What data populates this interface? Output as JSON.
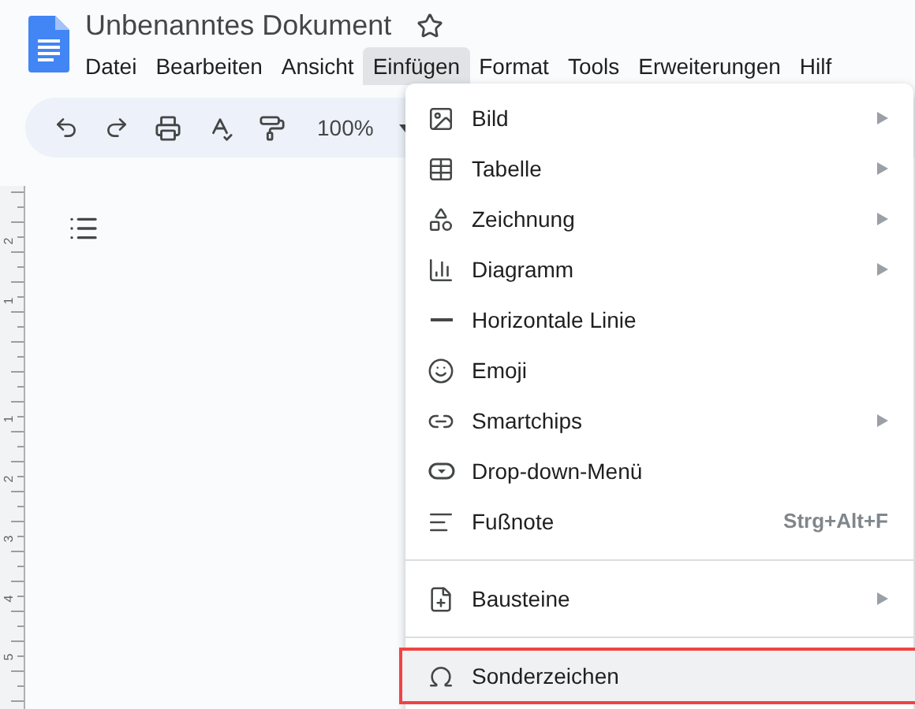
{
  "document": {
    "title": "Unbenanntes Dokument",
    "starred": false
  },
  "menubar": [
    {
      "label": "Datei",
      "selected": false
    },
    {
      "label": "Bearbeiten",
      "selected": false
    },
    {
      "label": "Ansicht",
      "selected": false
    },
    {
      "label": "Einfügen",
      "selected": true
    },
    {
      "label": "Format",
      "selected": false
    },
    {
      "label": "Tools",
      "selected": false
    },
    {
      "label": "Erweiterungen",
      "selected": false
    },
    {
      "label": "Hilf",
      "selected": false
    }
  ],
  "toolbar": {
    "zoom": "100%"
  },
  "ruler": {
    "labels": [
      "2",
      "1",
      "1",
      "2",
      "3",
      "4",
      "5"
    ]
  },
  "insert_menu": [
    {
      "kind": "item",
      "label": "Bild",
      "submenu": true,
      "selected": false
    },
    {
      "kind": "item",
      "label": "Tabelle",
      "submenu": true,
      "selected": false
    },
    {
      "kind": "item",
      "label": "Zeichnung",
      "submenu": true,
      "selected": false
    },
    {
      "kind": "item",
      "label": "Diagramm",
      "submenu": true,
      "selected": false
    },
    {
      "kind": "item",
      "label": "Horizontale Linie",
      "submenu": false,
      "selected": false
    },
    {
      "kind": "item",
      "label": "Emoji",
      "submenu": false,
      "selected": false
    },
    {
      "kind": "item",
      "label": "Smartchips",
      "submenu": true,
      "selected": false
    },
    {
      "kind": "item",
      "label": "Drop-down-Menü",
      "submenu": false,
      "selected": false
    },
    {
      "kind": "item",
      "label": "Fußnote",
      "shortcut": "Strg+Alt+F",
      "submenu": false,
      "selected": false
    },
    {
      "kind": "divider"
    },
    {
      "kind": "item",
      "label": "Bausteine",
      "submenu": true,
      "selected": false
    },
    {
      "kind": "divider"
    },
    {
      "kind": "item",
      "label": "Sonderzeichen",
      "submenu": false,
      "selected": true
    }
  ]
}
